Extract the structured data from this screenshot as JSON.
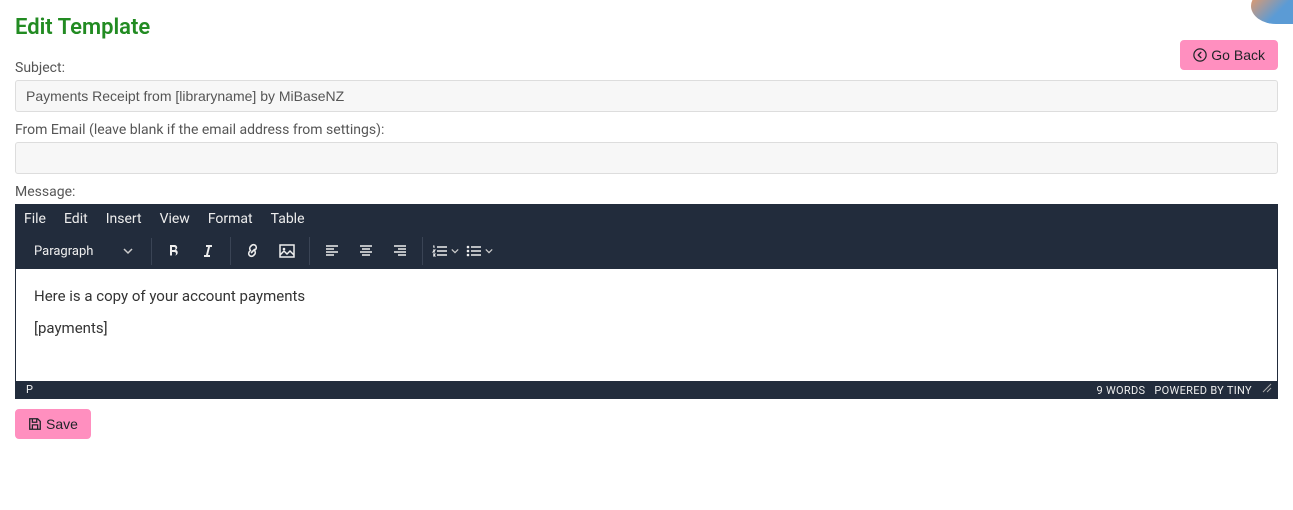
{
  "header": {
    "title": "Edit Template",
    "back_button": "Go Back"
  },
  "form": {
    "subject_label": "Subject:",
    "subject_value": "Payments Receipt from [libraryname] by MiBaseNZ",
    "from_label": "From Email (leave blank if the email address from settings):",
    "from_value": "",
    "message_label": "Message:",
    "save_button": "Save"
  },
  "editor": {
    "menu": {
      "file": "File",
      "edit": "Edit",
      "insert": "Insert",
      "view": "View",
      "format": "Format",
      "table": "Table"
    },
    "block_format": "Paragraph",
    "body_line1": "Here is a copy of your account payments",
    "body_line2": "[payments]",
    "status_path": "P",
    "word_count": "9 WORDS",
    "branding": "POWERED BY TINY"
  }
}
